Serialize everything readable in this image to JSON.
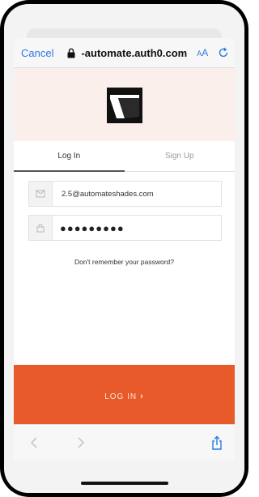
{
  "browser": {
    "cancel_label": "Cancel",
    "url": "-automate.auth0.com",
    "text_size_small": "A",
    "text_size_large": "A"
  },
  "tabs": {
    "login": "Log In",
    "signup": "Sign Up"
  },
  "form": {
    "email_value": "2.5@automateshades.com",
    "password_value": "●●●●●●●●●",
    "forgot_label": "Don't remember your password?"
  },
  "login_button": {
    "label": "LOG IN",
    "chevron": "›"
  },
  "colors": {
    "accent": "#e85a2a",
    "brand_band": "#fbefeb",
    "ios_blue": "#2a7ae2"
  },
  "icons": {
    "lock": "lock-icon",
    "reload": "reload-icon",
    "email": "envelope-icon",
    "password": "padlock-icon",
    "back": "back-arrow-icon",
    "forward": "forward-arrow-icon",
    "share": "share-icon"
  }
}
